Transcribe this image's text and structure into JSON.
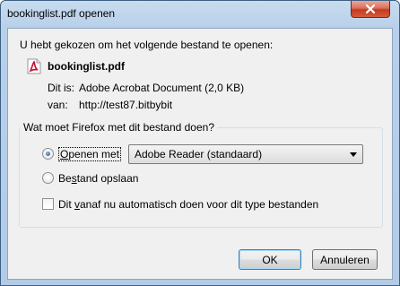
{
  "window": {
    "title": "bookinglist.pdf openen",
    "close_icon": "close-x-icon"
  },
  "dialog": {
    "intro": "U hebt gekozen om het volgende bestand te openen:",
    "file_icon": "pdf-file-icon",
    "filename": "bookinglist.pdf",
    "type_label": "Dit is:",
    "type_value": "Adobe Acrobat Document (2,0 KB)",
    "from_label": "van:",
    "from_value": "http://test87.bitbybit"
  },
  "options": {
    "legend": "Wat moet Firefox met dit bestand doen?",
    "open_with": {
      "prefix": "",
      "accel": "O",
      "suffix": "penen met",
      "checked": true
    },
    "open_app": "Adobe Reader  (standaard)",
    "save": {
      "prefix": "Be",
      "accel": "s",
      "suffix": "tand opslaan",
      "checked": false
    },
    "auto": {
      "prefix": "Dit ",
      "accel": "v",
      "suffix": "anaf nu automatisch doen voor dit type bestanden",
      "checked": false
    }
  },
  "buttons": {
    "ok": "OK",
    "cancel": "Annuleren"
  },
  "colors": {
    "titlebar": "#b8d0ea",
    "client": "#f0f0f0",
    "close": "#c6391f",
    "pdf_red": "#c8102e"
  }
}
